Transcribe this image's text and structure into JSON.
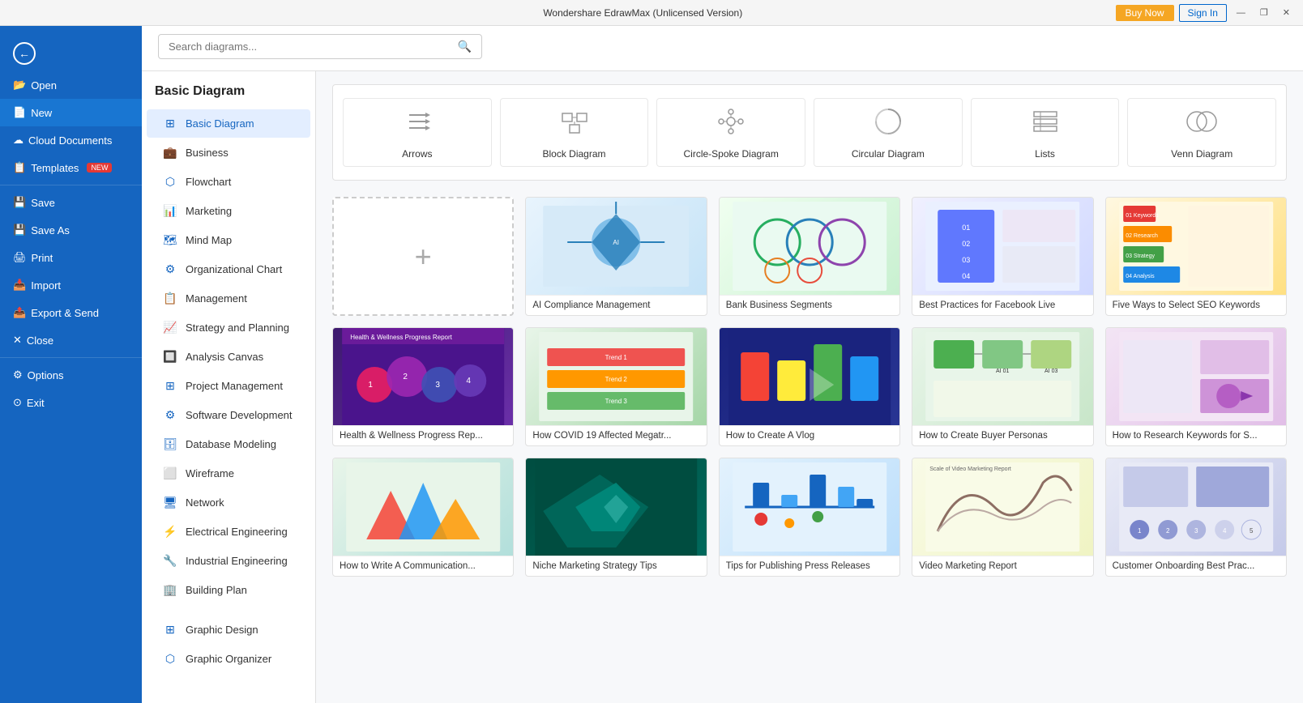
{
  "titleBar": {
    "title": "Wondershare EdrawMax (Unlicensed Version)",
    "controls": [
      "—",
      "❐",
      "✕"
    ],
    "buyNow": "Buy Now",
    "signIn": "Sign In"
  },
  "sidebar": {
    "backLabel": "←",
    "items": [
      {
        "label": "Open",
        "icon": "📂"
      },
      {
        "label": "New",
        "icon": "📄",
        "active": true
      },
      {
        "label": "Cloud Documents",
        "icon": "☁"
      },
      {
        "label": "Templates",
        "icon": "📋",
        "badge": "NEW"
      },
      {
        "label": "Save",
        "icon": "💾"
      },
      {
        "label": "Save As",
        "icon": "💾"
      },
      {
        "label": "Print",
        "icon": "🖨"
      },
      {
        "label": "Import",
        "icon": "📥"
      },
      {
        "label": "Export & Send",
        "icon": "📤"
      },
      {
        "label": "Close",
        "icon": "✕"
      },
      {
        "label": "Options",
        "icon": "⚙"
      },
      {
        "label": "Exit",
        "icon": "🚪"
      }
    ]
  },
  "subSidebar": {
    "header": "Basic Diagram",
    "items": [
      {
        "label": "Basic Diagram",
        "active": true
      },
      {
        "label": "Business"
      },
      {
        "label": "Flowchart"
      },
      {
        "label": "Marketing"
      },
      {
        "label": "Mind Map"
      },
      {
        "label": "Organizational Chart"
      },
      {
        "label": "Management"
      },
      {
        "label": "Strategy and Planning"
      },
      {
        "label": "Analysis Canvas"
      },
      {
        "label": "Project Management"
      },
      {
        "label": "Software Development"
      },
      {
        "label": "Database Modeling"
      },
      {
        "label": "Wireframe"
      },
      {
        "label": "Network"
      },
      {
        "label": "Electrical Engineering"
      },
      {
        "label": "Industrial Engineering"
      },
      {
        "label": "Building Plan"
      },
      {
        "label": "Graphic Design"
      },
      {
        "label": "Graphic Organizer"
      }
    ]
  },
  "search": {
    "placeholder": "Search diagrams..."
  },
  "categories": [
    {
      "label": "Arrows",
      "icon": "arrows"
    },
    {
      "label": "Block Diagram",
      "icon": "block"
    },
    {
      "label": "Circle-Spoke Diagram",
      "icon": "circle-spoke"
    },
    {
      "label": "Circular Diagram",
      "icon": "circular"
    },
    {
      "label": "Lists",
      "icon": "lists"
    },
    {
      "label": "Venn Diagram",
      "icon": "venn"
    }
  ],
  "templates": [
    {
      "label": "new",
      "isNew": true
    },
    {
      "label": "AI Compliance Management",
      "thumb": "compliance"
    },
    {
      "label": "Bank Business Segments",
      "thumb": "bank"
    },
    {
      "label": "Best Practices for Facebook Live",
      "thumb": "facebook"
    },
    {
      "label": "Five Ways to Select SEO Keywords",
      "thumb": "seo"
    },
    {
      "label": "Health & Wellness Progress Rep...",
      "thumb": "health"
    },
    {
      "label": "How COVID 19 Affected Megatr...",
      "thumb": "covid"
    },
    {
      "label": "How to Create A Vlog",
      "thumb": "vlog"
    },
    {
      "label": "How to Create Buyer Personas",
      "thumb": "buyer"
    },
    {
      "label": "How to Research Keywords for S...",
      "thumb": "keywords"
    },
    {
      "label": "How to Write A Communication...",
      "thumb": "comms"
    },
    {
      "label": "Niche Marketing Strategy Tips",
      "thumb": "niche"
    },
    {
      "label": "Tips for Publishing Press Releases",
      "thumb": "press"
    },
    {
      "label": "Video Marketing Report",
      "thumb": "video"
    },
    {
      "label": "Customer Onboarding Best Prac...",
      "thumb": "onboarding"
    }
  ]
}
